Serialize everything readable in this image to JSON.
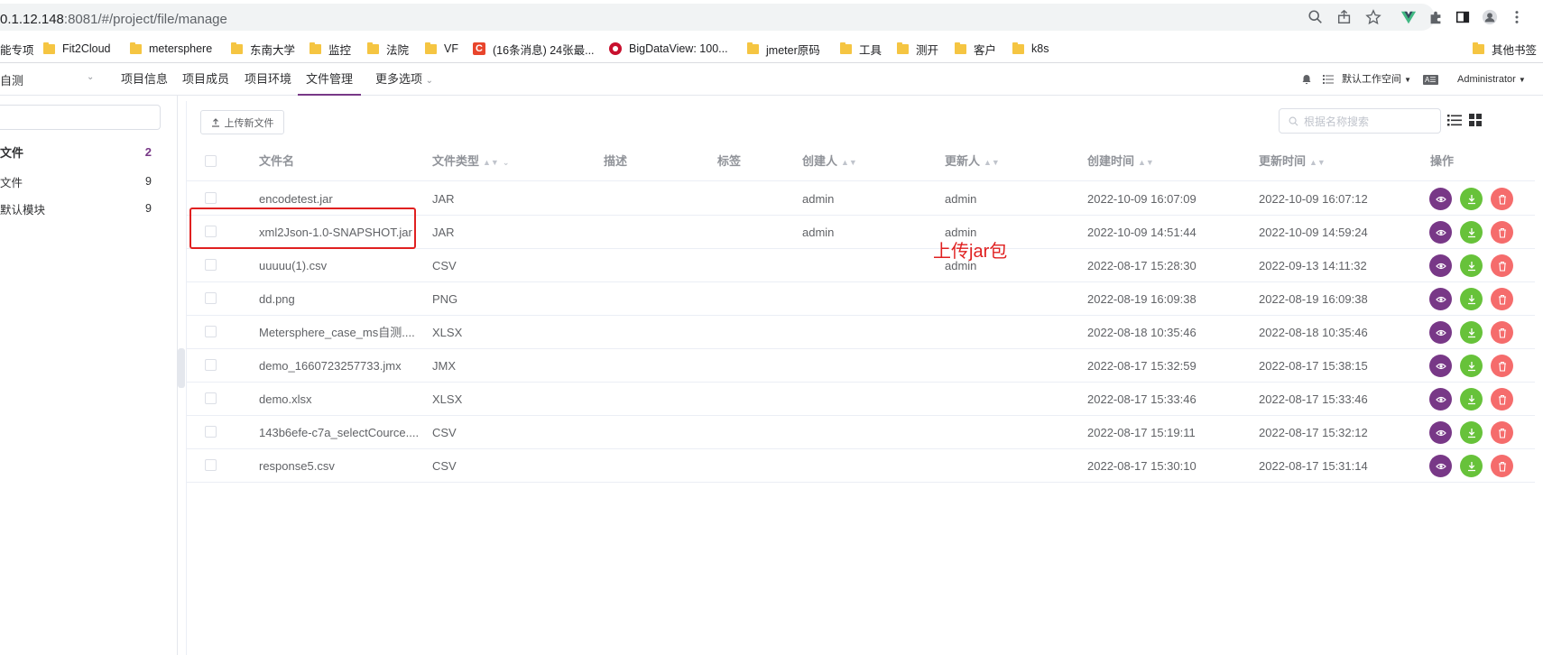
{
  "browser": {
    "url_host": "0.1.12.148",
    "url_path": ":8081/#/project/file/manage",
    "bookmarks": [
      {
        "label": "能专项",
        "icon": "none"
      },
      {
        "label": "Fit2Cloud",
        "icon": "folder-icon"
      },
      {
        "label": "metersphere",
        "icon": "folder-icon"
      },
      {
        "label": "东南大学",
        "icon": "folder-icon"
      },
      {
        "label": "监控",
        "icon": "folder-icon"
      },
      {
        "label": "法院",
        "icon": "folder-icon"
      },
      {
        "label": "VF",
        "icon": "folder-icon"
      },
      {
        "label": "(16条消息) 24张最...",
        "icon": "csdn-icon"
      },
      {
        "label": "BigDataView: 100...",
        "icon": "gitee-icon"
      },
      {
        "label": "jmeter原码",
        "icon": "folder-icon"
      },
      {
        "label": "工具",
        "icon": "folder-icon"
      },
      {
        "label": "测开",
        "icon": "folder-icon"
      },
      {
        "label": "客户",
        "icon": "folder-icon"
      },
      {
        "label": "k8s",
        "icon": "folder-icon"
      },
      {
        "label": "其他书签",
        "icon": "folder-icon"
      }
    ]
  },
  "header": {
    "project": "自测",
    "nav": [
      "项目信息",
      "项目成员",
      "项目环境",
      "文件管理",
      "更多选项"
    ],
    "active_nav": "文件管理",
    "workspace": "默认工作空间",
    "lang_badge": "A☰",
    "user": "Administrator"
  },
  "sidebar": {
    "items": [
      {
        "label": "文件",
        "count": "2"
      },
      {
        "label": "文件",
        "count": "9"
      },
      {
        "label": "默认模块",
        "count": "9"
      }
    ]
  },
  "toolbar": {
    "upload_label": "上传新文件",
    "search_placeholder": "根据名称搜索"
  },
  "table": {
    "columns": [
      "文件名",
      "文件类型",
      "描述",
      "标签",
      "创建人",
      "更新人",
      "创建时间",
      "更新时间",
      "操作"
    ],
    "rows": [
      {
        "name": "encodetest.jar",
        "type": "JAR",
        "creator": "admin",
        "updater": "admin",
        "created": "2022-10-09 16:07:09",
        "updated": "2022-10-09 16:07:12"
      },
      {
        "name": "xml2Json-1.0-SNAPSHOT.jar",
        "type": "JAR",
        "creator": "admin",
        "updater": "admin",
        "created": "2022-10-09 14:51:44",
        "updated": "2022-10-09 14:59:24"
      },
      {
        "name": "uuuuu(1).csv",
        "type": "CSV",
        "creator": "",
        "updater": "admin",
        "created": "2022-08-17 15:28:30",
        "updated": "2022-09-13 14:11:32"
      },
      {
        "name": "dd.png",
        "type": "PNG",
        "creator": "",
        "updater": "",
        "created": "2022-08-19 16:09:38",
        "updated": "2022-08-19 16:09:38"
      },
      {
        "name": "Metersphere_case_ms自测....",
        "type": "XLSX",
        "creator": "",
        "updater": "",
        "created": "2022-08-18 10:35:46",
        "updated": "2022-08-18 10:35:46"
      },
      {
        "name": "demo_1660723257733.jmx",
        "type": "JMX",
        "creator": "",
        "updater": "",
        "created": "2022-08-17 15:32:59",
        "updated": "2022-08-17 15:38:15"
      },
      {
        "name": "demo.xlsx",
        "type": "XLSX",
        "creator": "",
        "updater": "",
        "created": "2022-08-17 15:33:46",
        "updated": "2022-08-17 15:33:46"
      },
      {
        "name": "143b6efe-c7a_selectCource....",
        "type": "CSV",
        "creator": "",
        "updater": "",
        "created": "2022-08-17 15:19:11",
        "updated": "2022-08-17 15:32:12"
      },
      {
        "name": "response5.csv",
        "type": "CSV",
        "creator": "",
        "updater": "",
        "created": "2022-08-17 15:30:10",
        "updated": "2022-08-17 15:31:14"
      }
    ]
  },
  "annotation": {
    "text": "上传jar包",
    "color": "#e02020"
  },
  "colors": {
    "brand": "#783887",
    "view_button": "#783887",
    "download_button": "#67c23a",
    "delete_button": "#f56c6c"
  }
}
